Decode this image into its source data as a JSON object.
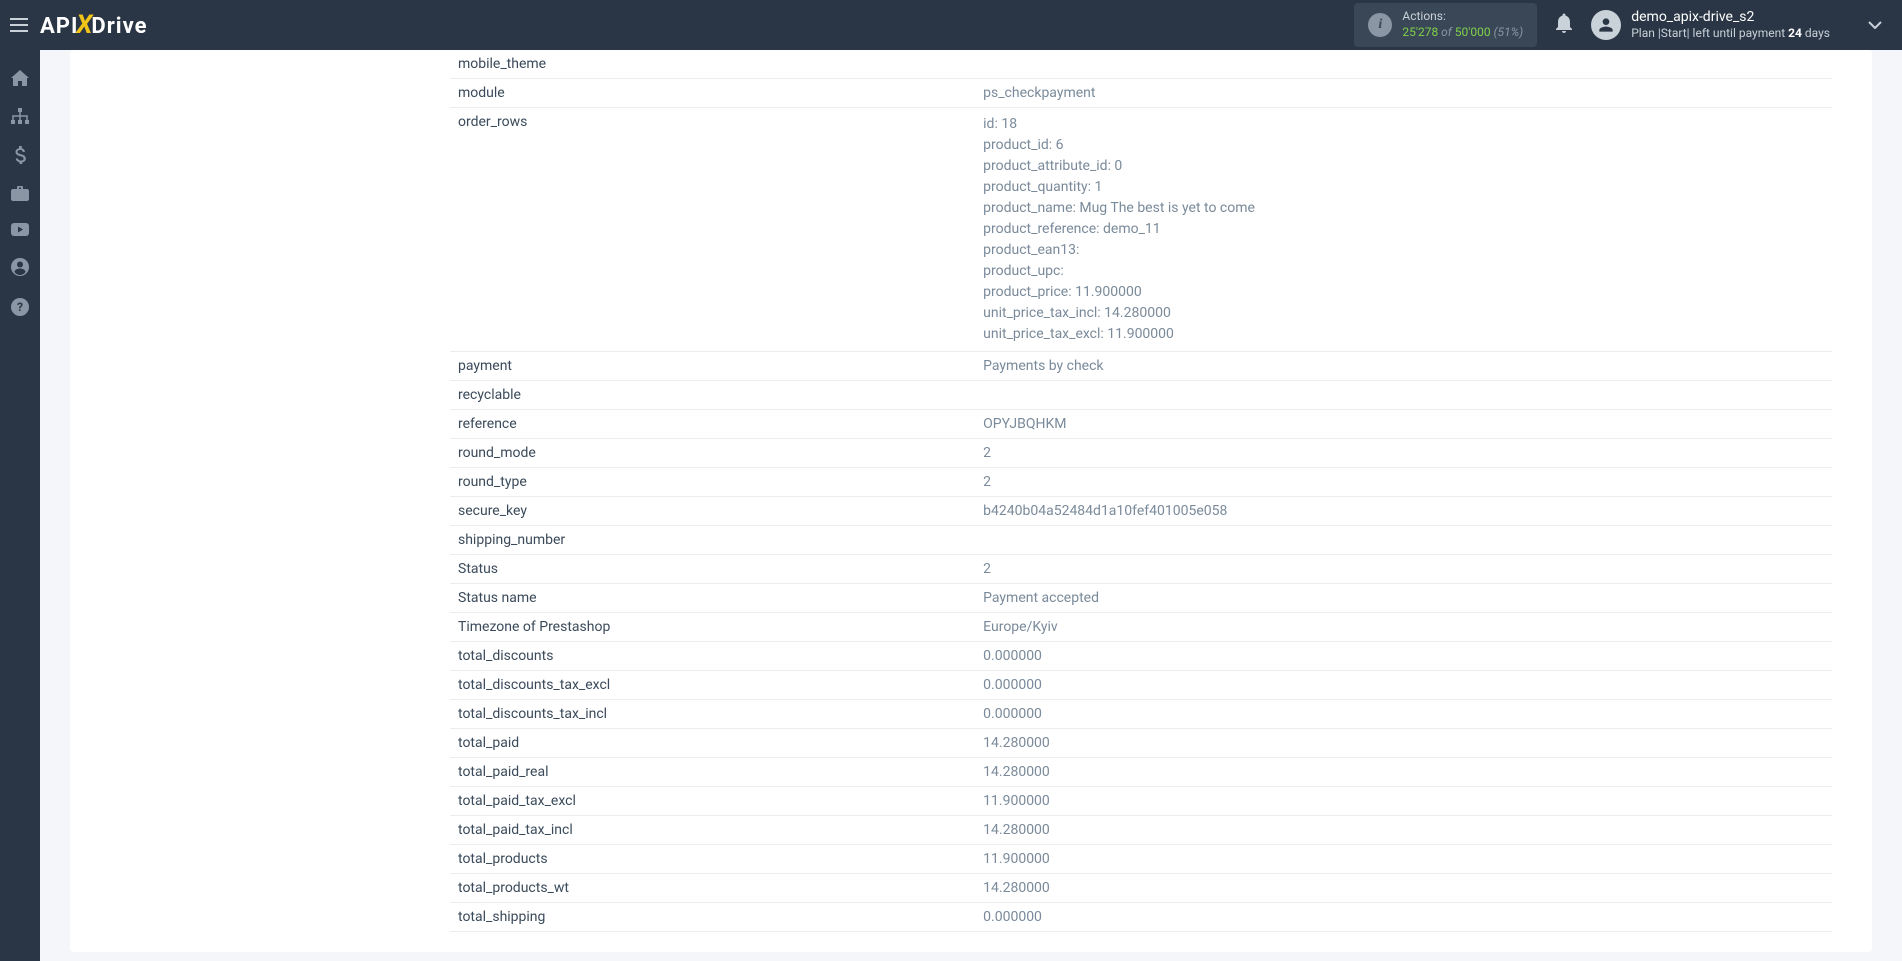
{
  "header": {
    "logo_api": "API",
    "logo_x": "X",
    "logo_drive": "Drive",
    "actions_label": "Actions:",
    "actions_used": "25'278",
    "actions_of": " of ",
    "actions_total": "50'000",
    "actions_pct": " (51%)",
    "username": "demo_apix-drive_s2",
    "plan_prefix": "Plan |Start| left until payment ",
    "plan_days": "24",
    "plan_suffix": " days"
  },
  "rows": [
    {
      "k": "mobile_theme",
      "v": ""
    },
    {
      "k": "module",
      "v": "ps_checkpayment"
    },
    {
      "k": "order_rows",
      "v": "id: 18\nproduct_id: 6\nproduct_attribute_id: 0\nproduct_quantity: 1\nproduct_name: Mug The best is yet to come\nproduct_reference: demo_11\nproduct_ean13:\nproduct_upc:\nproduct_price: 11.900000\nunit_price_tax_incl: 14.280000\nunit_price_tax_excl: 11.900000",
      "multi": true
    },
    {
      "k": "payment",
      "v": "Payments by check"
    },
    {
      "k": "recyclable",
      "v": ""
    },
    {
      "k": "reference",
      "v": "OPYJBQHKM"
    },
    {
      "k": "round_mode",
      "v": "2"
    },
    {
      "k": "round_type",
      "v": "2"
    },
    {
      "k": "secure_key",
      "v": "b4240b04a52484d1a10fef401005e058"
    },
    {
      "k": "shipping_number",
      "v": ""
    },
    {
      "k": "Status",
      "v": "2"
    },
    {
      "k": "Status name",
      "v": "Payment accepted"
    },
    {
      "k": "Timezone of Prestashop",
      "v": "Europe/Kyiv"
    },
    {
      "k": "total_discounts",
      "v": "0.000000"
    },
    {
      "k": "total_discounts_tax_excl",
      "v": "0.000000"
    },
    {
      "k": "total_discounts_tax_incl",
      "v": "0.000000"
    },
    {
      "k": "total_paid",
      "v": "14.280000"
    },
    {
      "k": "total_paid_real",
      "v": "14.280000"
    },
    {
      "k": "total_paid_tax_excl",
      "v": "11.900000"
    },
    {
      "k": "total_paid_tax_incl",
      "v": "14.280000"
    },
    {
      "k": "total_products",
      "v": "11.900000"
    },
    {
      "k": "total_products_wt",
      "v": "14.280000"
    },
    {
      "k": "total_shipping",
      "v": "0.000000"
    }
  ]
}
